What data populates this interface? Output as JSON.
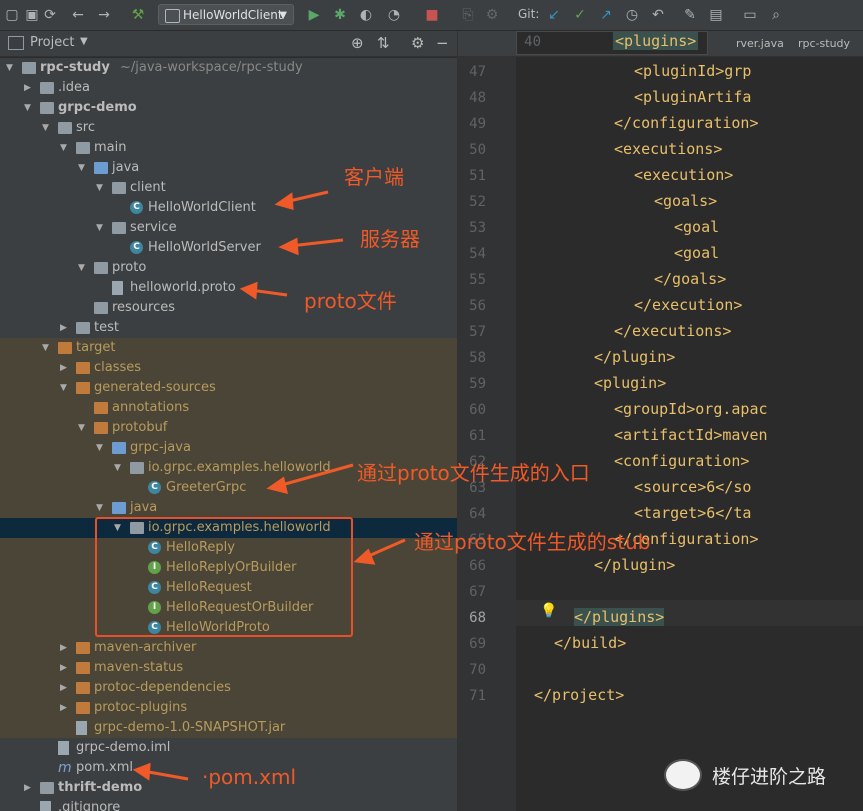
{
  "toolbar": {
    "run_config": "HelloWorldClient",
    "git_label": "Git:"
  },
  "project_panel": {
    "title": "Project"
  },
  "tree": [
    {
      "depth": 0,
      "arrow": "▼",
      "icon": "folder",
      "label": "rpc-study",
      "path": "~/java-workspace/rpc-study",
      "bold": true,
      "excl": false
    },
    {
      "depth": 1,
      "arrow": "▶",
      "icon": "folder",
      "label": ".idea",
      "path": "",
      "excl": false
    },
    {
      "depth": 1,
      "arrow": "▼",
      "icon": "folder",
      "label": "grpc-demo",
      "path": "",
      "bold": true,
      "excl": false
    },
    {
      "depth": 2,
      "arrow": "▼",
      "icon": "folder",
      "label": "src",
      "path": "",
      "excl": false
    },
    {
      "depth": 3,
      "arrow": "▼",
      "icon": "folder",
      "label": "main",
      "path": "",
      "excl": false
    },
    {
      "depth": 4,
      "arrow": "▼",
      "icon": "folder-blue",
      "label": "java",
      "path": "",
      "excl": false
    },
    {
      "depth": 5,
      "arrow": "▼",
      "icon": "folder",
      "label": "client",
      "path": "",
      "excl": false
    },
    {
      "depth": 6,
      "arrow": "",
      "icon": "class",
      "label": "HelloWorldClient",
      "path": "",
      "excl": false
    },
    {
      "depth": 5,
      "arrow": "▼",
      "icon": "folder",
      "label": "service",
      "path": "",
      "excl": false
    },
    {
      "depth": 6,
      "arrow": "",
      "icon": "class",
      "label": "HelloWorldServer",
      "path": "",
      "excl": false
    },
    {
      "depth": 4,
      "arrow": "▼",
      "icon": "folder",
      "label": "proto",
      "path": "",
      "excl": false
    },
    {
      "depth": 5,
      "arrow": "",
      "icon": "file",
      "label": "helloworld.proto",
      "path": "",
      "excl": false
    },
    {
      "depth": 4,
      "arrow": "",
      "icon": "folder",
      "label": "resources",
      "path": "",
      "excl": false
    },
    {
      "depth": 3,
      "arrow": "▶",
      "icon": "folder",
      "label": "test",
      "path": "",
      "excl": false
    },
    {
      "depth": 2,
      "arrow": "▼",
      "icon": "folder-orange",
      "label": "target",
      "path": "",
      "excl": true,
      "yellow": true
    },
    {
      "depth": 3,
      "arrow": "▶",
      "icon": "folder-orange",
      "label": "classes",
      "path": "",
      "excl": true,
      "yellow": true
    },
    {
      "depth": 3,
      "arrow": "▼",
      "icon": "folder-orange",
      "label": "generated-sources",
      "path": "",
      "excl": true,
      "yellow": true
    },
    {
      "depth": 4,
      "arrow": "",
      "icon": "folder-orange",
      "label": "annotations",
      "path": "",
      "excl": true,
      "yellow": true
    },
    {
      "depth": 4,
      "arrow": "▼",
      "icon": "folder-orange",
      "label": "protobuf",
      "path": "",
      "excl": true,
      "yellow": true
    },
    {
      "depth": 5,
      "arrow": "▼",
      "icon": "folder-blue",
      "label": "grpc-java",
      "path": "",
      "excl": true,
      "yellow": true
    },
    {
      "depth": 6,
      "arrow": "▼",
      "icon": "folder",
      "label": "io.grpc.examples.helloworld",
      "path": "",
      "excl": true,
      "yellow": true
    },
    {
      "depth": 7,
      "arrow": "",
      "icon": "class",
      "label": "GreeterGrpc",
      "path": "",
      "excl": true,
      "yellow": true
    },
    {
      "depth": 5,
      "arrow": "▼",
      "icon": "folder-blue",
      "label": "java",
      "path": "",
      "excl": true,
      "yellow": true
    },
    {
      "depth": 6,
      "arrow": "▼",
      "icon": "folder",
      "label": "io.grpc.examples.helloworld",
      "path": "",
      "sel": true,
      "yellow": true
    },
    {
      "depth": 7,
      "arrow": "",
      "icon": "class",
      "label": "HelloReply",
      "path": "",
      "excl": true,
      "yellow": true
    },
    {
      "depth": 7,
      "arrow": "",
      "icon": "iface",
      "label": "HelloReplyOrBuilder",
      "path": "",
      "excl": true,
      "yellow": true
    },
    {
      "depth": 7,
      "arrow": "",
      "icon": "class",
      "label": "HelloRequest",
      "path": "",
      "excl": true,
      "yellow": true
    },
    {
      "depth": 7,
      "arrow": "",
      "icon": "iface",
      "label": "HelloRequestOrBuilder",
      "path": "",
      "excl": true,
      "yellow": true
    },
    {
      "depth": 7,
      "arrow": "",
      "icon": "class",
      "label": "HelloWorldProto",
      "path": "",
      "excl": true,
      "yellow": true
    },
    {
      "depth": 3,
      "arrow": "▶",
      "icon": "folder-orange",
      "label": "maven-archiver",
      "path": "",
      "excl": true,
      "yellow": true
    },
    {
      "depth": 3,
      "arrow": "▶",
      "icon": "folder-orange",
      "label": "maven-status",
      "path": "",
      "excl": true,
      "yellow": true
    },
    {
      "depth": 3,
      "arrow": "▶",
      "icon": "folder-orange",
      "label": "protoc-dependencies",
      "path": "",
      "excl": true,
      "yellow": true
    },
    {
      "depth": 3,
      "arrow": "▶",
      "icon": "folder-orange",
      "label": "protoc-plugins",
      "path": "",
      "excl": true,
      "yellow": true
    },
    {
      "depth": 3,
      "arrow": "",
      "icon": "file",
      "label": "grpc-demo-1.0-SNAPSHOT.jar",
      "path": "",
      "excl": true,
      "yellow": true
    },
    {
      "depth": 2,
      "arrow": "",
      "icon": "file",
      "label": "grpc-demo.iml",
      "path": "",
      "excl": false
    },
    {
      "depth": 2,
      "arrow": "",
      "icon": "maven",
      "label": "pom.xml",
      "path": "",
      "excl": false
    },
    {
      "depth": 1,
      "arrow": "▶",
      "icon": "folder",
      "label": "thrift-demo",
      "path": "",
      "bold": true,
      "excl": false
    },
    {
      "depth": 1,
      "arrow": "",
      "icon": "file",
      "label": ".gitignore",
      "path": "",
      "excl": false
    }
  ],
  "editor": {
    "tabs": [
      "rver.java",
      "rpc-study"
    ],
    "sticky_line": {
      "num": "40",
      "text": "<plugins>"
    },
    "lines": [
      {
        "num": "47",
        "indent": 10,
        "text": "<pluginId>grp",
        "hl": false
      },
      {
        "num": "48",
        "indent": 10,
        "text": "<pluginArtifa",
        "hl": false
      },
      {
        "num": "49",
        "indent": 8,
        "text": "</configuration>",
        "hl": false
      },
      {
        "num": "50",
        "indent": 8,
        "text": "<executions>",
        "hl": false
      },
      {
        "num": "51",
        "indent": 10,
        "text": "<execution>",
        "hl": false
      },
      {
        "num": "52",
        "indent": 12,
        "text": "<goals>",
        "hl": false
      },
      {
        "num": "53",
        "indent": 14,
        "text": "<goal",
        "hl": false
      },
      {
        "num": "54",
        "indent": 14,
        "text": "<goal",
        "hl": false
      },
      {
        "num": "55",
        "indent": 12,
        "text": "</goals>",
        "hl": false
      },
      {
        "num": "56",
        "indent": 10,
        "text": "</execution>",
        "hl": false
      },
      {
        "num": "57",
        "indent": 8,
        "text": "</executions>",
        "hl": false
      },
      {
        "num": "58",
        "indent": 6,
        "text": "</plugin>",
        "hl": false
      },
      {
        "num": "59",
        "indent": 6,
        "text": "<plugin>",
        "hl": false
      },
      {
        "num": "60",
        "indent": 8,
        "text": "<groupId>org.apac",
        "hl": false
      },
      {
        "num": "61",
        "indent": 8,
        "text": "<artifactId>maven",
        "hl": false
      },
      {
        "num": "62",
        "indent": 8,
        "text": "<configuration>",
        "hl": false
      },
      {
        "num": "63",
        "indent": 10,
        "text": "<source>6</so",
        "hl": false
      },
      {
        "num": "64",
        "indent": 10,
        "text": "<target>6</ta",
        "hl": false
      },
      {
        "num": "65",
        "indent": 8,
        "text": "</configuration>",
        "hl": false
      },
      {
        "num": "66",
        "indent": 6,
        "text": "</plugin>",
        "hl": false
      },
      {
        "num": "67",
        "indent": 0,
        "text": "",
        "hl": false
      },
      {
        "num": "68",
        "indent": 4,
        "text": "</plugins>",
        "hl": true
      },
      {
        "num": "69",
        "indent": 2,
        "text": "</build>",
        "hl": false
      },
      {
        "num": "70",
        "indent": 0,
        "text": "",
        "hl": false
      },
      {
        "num": "71",
        "indent": 0,
        "text": "</project>",
        "hl": false
      }
    ]
  },
  "annotations": {
    "client": "客户端",
    "server": "服务器",
    "proto": "proto文件",
    "grpc_entry": "通过proto文件生成的入口",
    "stub": "通过proto文件生成的stub",
    "pom": "·pom.xml"
  },
  "watermark": "楼仔进阶之路",
  "colors": {
    "annotation": "#f05a28",
    "excluded_bg": "#4a4536",
    "selected_bg": "#0d293e"
  }
}
